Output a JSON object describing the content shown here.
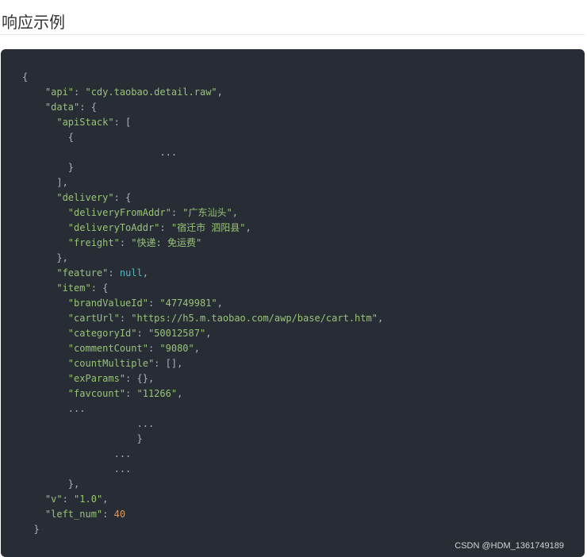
{
  "section": {
    "title": "响应示例"
  },
  "code": {
    "lines": [
      [
        {
          "t": "{",
          "c": "p"
        }
      ],
      [
        {
          "t": "    ",
          "c": "p"
        },
        {
          "t": "\"api\"",
          "c": "k"
        },
        {
          "t": ": ",
          "c": "p"
        },
        {
          "t": "\"cdy.taobao.detail.raw\"",
          "c": "s"
        },
        {
          "t": ",",
          "c": "p"
        }
      ],
      [
        {
          "t": "    ",
          "c": "p"
        },
        {
          "t": "\"data\"",
          "c": "k"
        },
        {
          "t": ": {",
          "c": "p"
        }
      ],
      [
        {
          "t": "      ",
          "c": "p"
        },
        {
          "t": "\"apiStack\"",
          "c": "k"
        },
        {
          "t": ": [",
          "c": "p"
        }
      ],
      [
        {
          "t": "        {",
          "c": "p"
        }
      ],
      [
        {
          "t": "                        ...",
          "c": "p"
        }
      ],
      [
        {
          "t": "        }",
          "c": "p"
        }
      ],
      [
        {
          "t": "      ],",
          "c": "p"
        }
      ],
      [
        {
          "t": "      ",
          "c": "p"
        },
        {
          "t": "\"delivery\"",
          "c": "k"
        },
        {
          "t": ": {",
          "c": "p"
        }
      ],
      [
        {
          "t": "        ",
          "c": "p"
        },
        {
          "t": "\"deliveryFromAddr\"",
          "c": "k"
        },
        {
          "t": ": ",
          "c": "p"
        },
        {
          "t": "\"广东汕头\"",
          "c": "s"
        },
        {
          "t": ",",
          "c": "p"
        }
      ],
      [
        {
          "t": "        ",
          "c": "p"
        },
        {
          "t": "\"deliveryToAddr\"",
          "c": "k"
        },
        {
          "t": ": ",
          "c": "p"
        },
        {
          "t": "\"宿迁市 泗阳县\"",
          "c": "s"
        },
        {
          "t": ",",
          "c": "p"
        }
      ],
      [
        {
          "t": "        ",
          "c": "p"
        },
        {
          "t": "\"freight\"",
          "c": "k"
        },
        {
          "t": ": ",
          "c": "p"
        },
        {
          "t": "\"快递: 免运费\"",
          "c": "s"
        }
      ],
      [
        {
          "t": "      },",
          "c": "p"
        }
      ],
      [
        {
          "t": "      ",
          "c": "p"
        },
        {
          "t": "\"feature\"",
          "c": "k"
        },
        {
          "t": ": ",
          "c": "p"
        },
        {
          "t": "null",
          "c": "nul"
        },
        {
          "t": ",",
          "c": "p"
        }
      ],
      [
        {
          "t": "      ",
          "c": "p"
        },
        {
          "t": "\"item\"",
          "c": "k"
        },
        {
          "t": ": {",
          "c": "p"
        }
      ],
      [
        {
          "t": "        ",
          "c": "p"
        },
        {
          "t": "\"brandValueId\"",
          "c": "k"
        },
        {
          "t": ": ",
          "c": "p"
        },
        {
          "t": "\"47749981\"",
          "c": "s"
        },
        {
          "t": ",",
          "c": "p"
        }
      ],
      [
        {
          "t": "        ",
          "c": "p"
        },
        {
          "t": "\"cartUrl\"",
          "c": "k"
        },
        {
          "t": ": ",
          "c": "p"
        },
        {
          "t": "\"https://h5.m.taobao.com/awp/base/cart.htm\"",
          "c": "s"
        },
        {
          "t": ",",
          "c": "p"
        }
      ],
      [
        {
          "t": "        ",
          "c": "p"
        },
        {
          "t": "\"categoryId\"",
          "c": "k"
        },
        {
          "t": ": ",
          "c": "p"
        },
        {
          "t": "\"50012587\"",
          "c": "s"
        },
        {
          "t": ",",
          "c": "p"
        }
      ],
      [
        {
          "t": "        ",
          "c": "p"
        },
        {
          "t": "\"commentCount\"",
          "c": "k"
        },
        {
          "t": ": ",
          "c": "p"
        },
        {
          "t": "\"9080\"",
          "c": "s"
        },
        {
          "t": ",",
          "c": "p"
        }
      ],
      [
        {
          "t": "        ",
          "c": "p"
        },
        {
          "t": "\"countMultiple\"",
          "c": "k"
        },
        {
          "t": ": [],",
          "c": "p"
        }
      ],
      [
        {
          "t": "        ",
          "c": "p"
        },
        {
          "t": "\"exParams\"",
          "c": "k"
        },
        {
          "t": ": {},",
          "c": "p"
        }
      ],
      [
        {
          "t": "        ",
          "c": "p"
        },
        {
          "t": "\"favcount\"",
          "c": "k"
        },
        {
          "t": ": ",
          "c": "p"
        },
        {
          "t": "\"11266\"",
          "c": "s"
        },
        {
          "t": ",",
          "c": "p"
        }
      ],
      [
        {
          "t": "        ...",
          "c": "p"
        }
      ],
      [
        {
          "t": "                    ...",
          "c": "p"
        }
      ],
      [
        {
          "t": "                    }",
          "c": "p"
        }
      ],
      [
        {
          "t": "                ...",
          "c": "p"
        }
      ],
      [
        {
          "t": "                ...",
          "c": "p"
        }
      ],
      [
        {
          "t": "        },",
          "c": "p"
        }
      ],
      [
        {
          "t": "    ",
          "c": "p"
        },
        {
          "t": "\"v\"",
          "c": "k"
        },
        {
          "t": ": ",
          "c": "p"
        },
        {
          "t": "\"1.0\"",
          "c": "s"
        },
        {
          "t": ",",
          "c": "p"
        }
      ],
      [
        {
          "t": "    ",
          "c": "p"
        },
        {
          "t": "\"left_num\"",
          "c": "k"
        },
        {
          "t": ": ",
          "c": "p"
        },
        {
          "t": "40",
          "c": "num"
        }
      ],
      [
        {
          "t": "  }",
          "c": "p"
        }
      ]
    ]
  },
  "watermark": {
    "text": "CSDN @HDM_1361749189"
  },
  "colors": {
    "code_background": "#282c34",
    "code_key": "#98c379",
    "code_string": "#98c379",
    "code_null": "#56b6c2",
    "code_number": "#d19a66",
    "code_punctuation": "#abb2bf"
  }
}
